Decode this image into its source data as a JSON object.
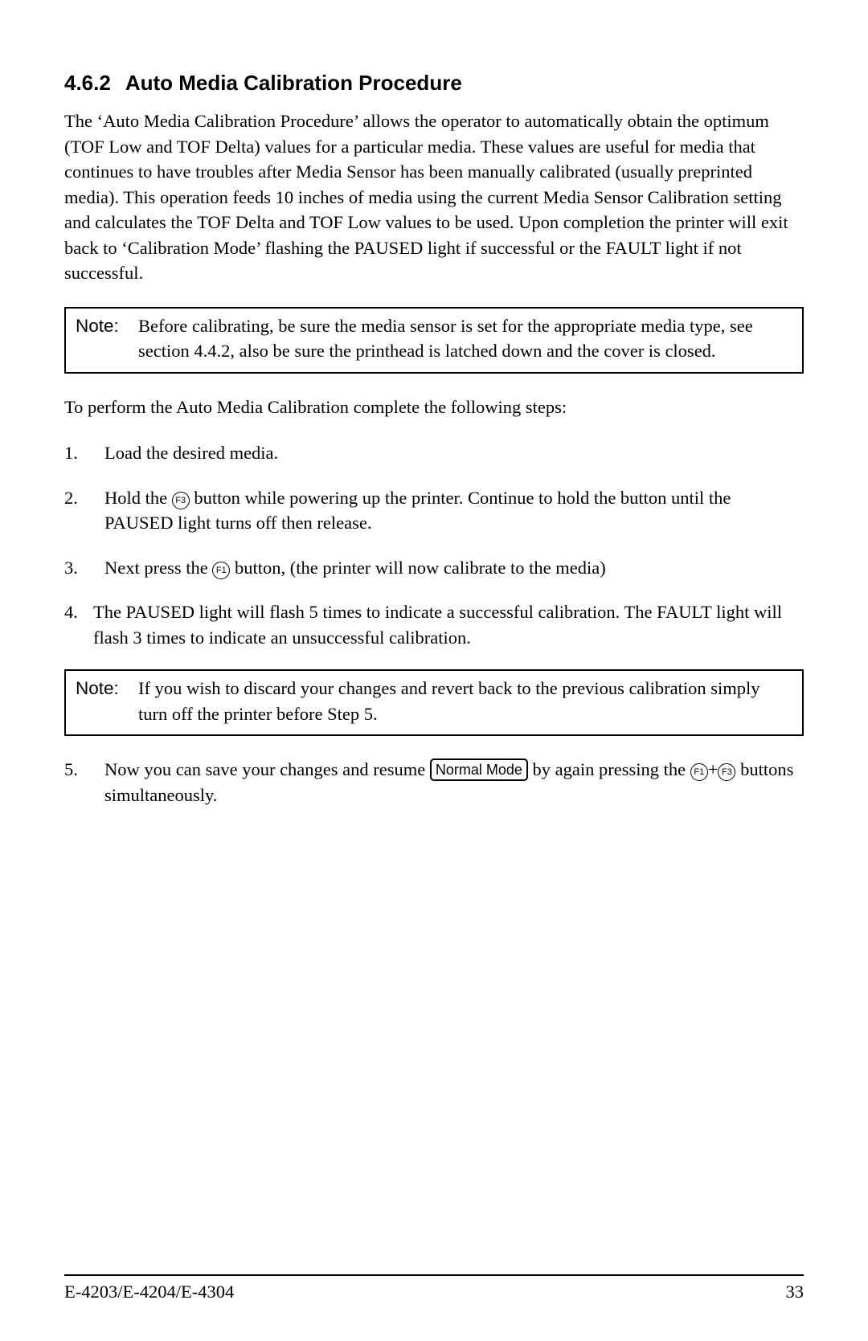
{
  "heading": {
    "number": "4.6.2",
    "title": "Auto Media Calibration Procedure"
  },
  "intro_para": "The ‘Auto Media Calibration Procedure’ allows the operator to automatically obtain the optimum (TOF Low and TOF Delta) values for a particular media.  These values are useful for media that continues to have troubles after Media Sensor has been manually calibrated (usually preprinted media).  This operation feeds 10 inches of media using the current Media Sensor Calibration setting and calculates the TOF Delta and TOF Low values to be used. Upon completion the printer will exit back to ‘Calibration Mode’ flashing the PAUSED light if successful or the FAULT light if not successful.",
  "note1": {
    "label": "Note:",
    "text": "Before calibrating, be sure the media sensor is set for the appropriate media type, see section 4.4.2, also be sure the printhead is latched down and the cover is closed."
  },
  "steps_intro": "To perform the Auto Media Calibration complete the following steps:",
  "steps": {
    "s1": {
      "num": "1.",
      "text": "Load the desired media."
    },
    "s2": {
      "num": "2.",
      "pre": "Hold the ",
      "btn": "F3",
      "post": " button while powering up the printer.  Continue to hold the button until the PAUSED light turns off then release."
    },
    "s3": {
      "num": "3.",
      "pre": "Next press the ",
      "btn": "F1",
      "post": " button, (the printer will now calibrate to the media)"
    },
    "s4": {
      "num": "4.",
      "text": "The PAUSED light will flash 5 times to indicate a successful calibration.  The FAULT light will flash 3 times to indicate an unsuccessful calibration."
    },
    "s5": {
      "num": "5.",
      "pre": "Now you can save your changes and resume ",
      "boxed": "Normal Mode",
      "mid": " by again pressing the ",
      "btn1": "F1",
      "plus": "+",
      "btn2": "F3",
      "post": " buttons simultaneously."
    }
  },
  "note2": {
    "label": "Note:",
    "text": "If you wish to discard your changes and revert back to the previous calibration simply turn off the printer before Step 5."
  },
  "footer": {
    "left": "E-4203/E-4204/E-4304",
    "right": "33"
  }
}
